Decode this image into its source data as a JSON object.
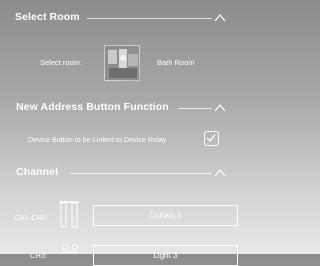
{
  "select_room": {
    "title": "Select Room",
    "label": "Select room:",
    "room_name": "Bath Room"
  },
  "address_function": {
    "title": "New Address Button Function",
    "option_label": "Device Button to be Linked to Device Relay",
    "checked": true
  },
  "channel": {
    "title": "Channel",
    "rows": [
      {
        "label": "CH1 CH2:",
        "value": "Curtain 1"
      },
      {
        "label": "CH3:",
        "value": "Light 3"
      }
    ]
  },
  "icons": {
    "collapse": "chevron-up-icon",
    "room": "bathroom-photo",
    "check": "checkmark-icon",
    "curtain": "curtain-icon",
    "light": "ceiling-light-icon"
  }
}
